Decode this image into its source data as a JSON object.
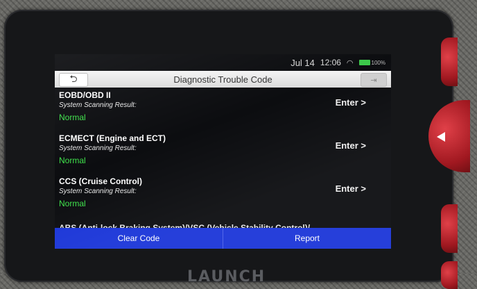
{
  "status_bar": {
    "date": "Jul 14",
    "time": "12:06",
    "battery_label": "100%"
  },
  "header": {
    "title": "Diagnostic Trouble Code",
    "back_icon": "back-arrow-icon",
    "exit_icon": "exit-icon"
  },
  "systems": [
    {
      "name": "EOBD/OBD II",
      "scan_label": "System Scanning Result:",
      "result": "Normal",
      "action": "Enter >"
    },
    {
      "name": "ECMECT (Engine and ECT)",
      "scan_label": "System Scanning Result:",
      "result": "Normal",
      "action": "Enter >"
    },
    {
      "name": "CCS (Cruise Control)",
      "scan_label": "System Scanning Result:",
      "result": "Normal",
      "action": "Enter >"
    }
  ],
  "partial_row": "ABS (Anti-lock Braking System)/VSC (Vehicle Stability Control)/",
  "footer": {
    "clear_label": "Clear Code",
    "report_label": "Report"
  },
  "device": {
    "brand": "LAUNCH"
  },
  "colors": {
    "result_normal": "#3ee24a",
    "action_bar": "#1a35d8"
  }
}
